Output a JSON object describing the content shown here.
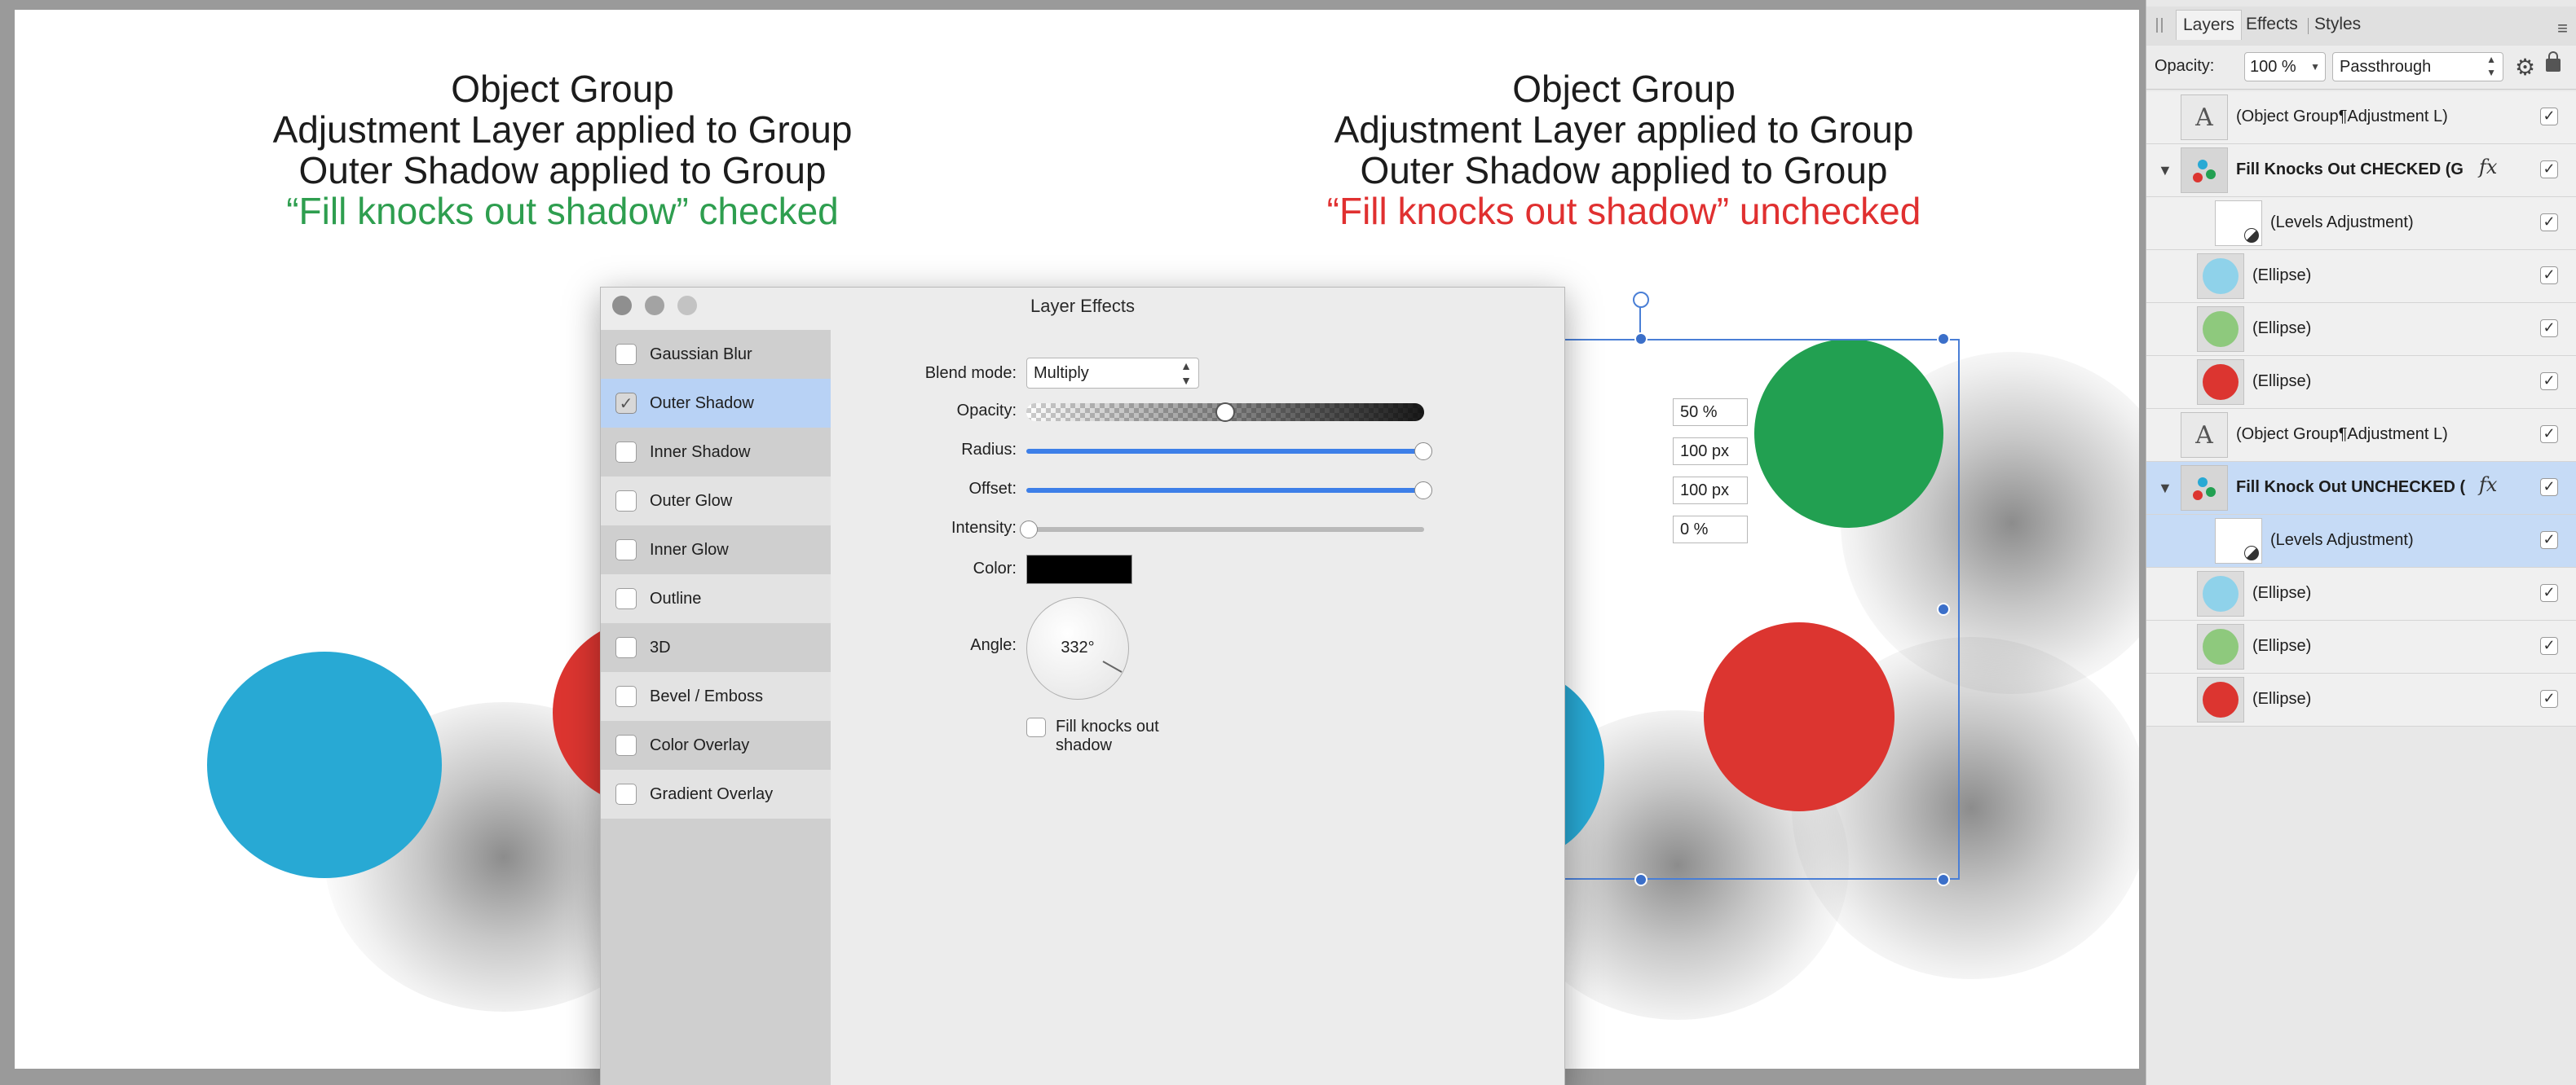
{
  "canvas": {
    "left_caption": {
      "line1": "Object Group",
      "line2": "Adjustment Layer applied to Group",
      "line3": "Outer Shadow applied to Group",
      "line4": "“Fill knocks out shadow” checked",
      "line4_color": "#2e9e4f"
    },
    "right_caption": {
      "line1": "Object Group",
      "line2": "Adjustment Layer applied to Group",
      "line3": "Outer Shadow applied to Group",
      "line4": "“Fill knocks out shadow” unchecked",
      "line4_color": "#e03030"
    },
    "colors": {
      "blue": "#28a9d4",
      "green": "#22a051",
      "red": "#dc3530"
    }
  },
  "dialog": {
    "title": "Layer Effects",
    "effects": [
      {
        "label": "Gaussian Blur",
        "checked": false
      },
      {
        "label": "Outer Shadow",
        "checked": true
      },
      {
        "label": "Inner Shadow",
        "checked": false
      },
      {
        "label": "Outer Glow",
        "checked": false
      },
      {
        "label": "Inner Glow",
        "checked": false
      },
      {
        "label": "Outline",
        "checked": false
      },
      {
        "label": "3D",
        "checked": false
      },
      {
        "label": "Bevel / Emboss",
        "checked": false
      },
      {
        "label": "Color Overlay",
        "checked": false
      },
      {
        "label": "Gradient Overlay",
        "checked": false
      }
    ],
    "blend_mode_label": "Blend mode:",
    "blend_mode_value": "Multiply",
    "opacity_label": "Opacity:",
    "opacity_value": "50 %",
    "opacity_fraction": 0.5,
    "radius_label": "Radius:",
    "radius_value": "100 px",
    "offset_label": "Offset:",
    "offset_value": "100 px",
    "intensity_label": "Intensity:",
    "intensity_value": "0 %",
    "color_label": "Color:",
    "shadow_color": "#000000",
    "angle_label": "Angle:",
    "angle_value": "332°",
    "fill_knocks_label": "Fill knocks out shadow",
    "fill_knocks_checked": false
  },
  "panel": {
    "tabs": [
      "Layers",
      "Effects",
      "Styles"
    ],
    "opacity_label": "Opacity:",
    "opacity_value": "100 %",
    "blend_value": "Passthrough",
    "layers": [
      {
        "name": "(Object Group¶Adjustment L)",
        "type": "text",
        "indent": 0,
        "bold": false,
        "fx": false,
        "highlight": false
      },
      {
        "name": "Fill Knocks Out CHECKED (G",
        "type": "group",
        "indent": 0,
        "bold": true,
        "fx": true,
        "highlight": false,
        "expanded": true
      },
      {
        "name": "(Levels Adjustment)",
        "type": "adjust",
        "indent": 1,
        "bold": false,
        "fx": false,
        "highlight": false
      },
      {
        "name": "(Ellipse)",
        "type": "ellipse",
        "color": "#8fd2ea",
        "indent": 1,
        "bold": false,
        "fx": false,
        "highlight": false
      },
      {
        "name": "(Ellipse)",
        "type": "ellipse",
        "color": "#8ec97d",
        "indent": 1,
        "bold": false,
        "fx": false,
        "highlight": false
      },
      {
        "name": "(Ellipse)",
        "type": "ellipse",
        "color": "#dc3530",
        "indent": 1,
        "bold": false,
        "fx": false,
        "highlight": false
      },
      {
        "name": "(Object Group¶Adjustment L)",
        "type": "text",
        "indent": 0,
        "bold": false,
        "fx": false,
        "highlight": false
      },
      {
        "name": "Fill Knock Out UNCHECKED (",
        "type": "group",
        "indent": 0,
        "bold": true,
        "fx": true,
        "highlight": true,
        "expanded": true
      },
      {
        "name": "(Levels Adjustment)",
        "type": "adjust",
        "indent": 1,
        "bold": false,
        "fx": false,
        "highlight": true
      },
      {
        "name": "(Ellipse)",
        "type": "ellipse",
        "color": "#8fd2ea",
        "indent": 1,
        "bold": false,
        "fx": false,
        "highlight": false
      },
      {
        "name": "(Ellipse)",
        "type": "ellipse",
        "color": "#8ec97d",
        "indent": 1,
        "bold": false,
        "fx": false,
        "highlight": false
      },
      {
        "name": "(Ellipse)",
        "type": "ellipse",
        "color": "#dc3530",
        "indent": 1,
        "bold": false,
        "fx": false,
        "highlight": false
      }
    ],
    "text_thumb_glyph": "A",
    "check_glyph": "✓",
    "fx_glyph": "fx"
  }
}
